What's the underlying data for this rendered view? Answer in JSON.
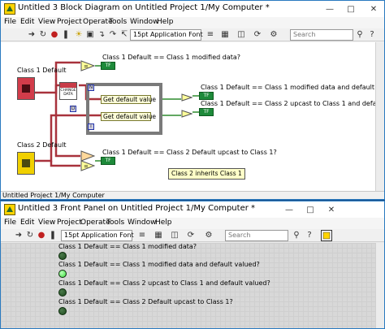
{
  "block_diagram": {
    "title": "Untitled 3 Block Diagram on Untitled Project 1/My Computer *",
    "menu": [
      "File",
      "Edit",
      "View",
      "Project",
      "Operate",
      "Tools",
      "Window",
      "Help"
    ],
    "font_selector": "15pt Application Font",
    "search_placeholder": "Search",
    "status": "Untitled Project 1/My Computer",
    "class1_label": "Class 1 Default",
    "class2_label": "Class 2 Default",
    "change_data_label": "CHANGE DATA",
    "get_default_value_1": "Get default value",
    "get_default_value_2": "Get default value",
    "indicator_text": "TF",
    "tunnel_n": "N",
    "tunnel_i": "i",
    "tunnel_d": "D",
    "outputs": [
      "Class 1 Default == Class 1 modified data?",
      "Class 1 Default == Class 1 modified data and default valued?",
      "Class 1 Default == Class 2 upcast to Class 1 and default valued?",
      "Class 1 Default == Class 2 Default upcast to Class 1?"
    ],
    "comment": "Class 2 inherits Class 1"
  },
  "front_panel": {
    "title": "Untitled 3 Front Panel on Untitled Project 1/My Computer *",
    "menu": [
      "File",
      "Edit",
      "View",
      "Project",
      "Operate",
      "Tools",
      "Window",
      "Help"
    ],
    "font_selector": "15pt Application Font",
    "search_placeholder": "Search",
    "indicators": [
      {
        "label": "Class 1 Default == Class 1 modified data?",
        "on": false
      },
      {
        "label": "Class 1 Default == Class 1 modified data and default valued?",
        "on": true
      },
      {
        "label": "Class 1 Default == Class 2 upcast to Class 1 and default valued?",
        "on": false
      },
      {
        "label": "Class 1 Default == Class 2 Default upcast to Class 1?",
        "on": false
      }
    ]
  },
  "colors": {
    "led_on": "#3ee03e",
    "led_off": "#1f4a1f",
    "wire_class": "#a8323c",
    "wire_bool": "#2e8b2e",
    "while_loop": "#7a7a7a",
    "desktop": "#1a4f8a"
  }
}
